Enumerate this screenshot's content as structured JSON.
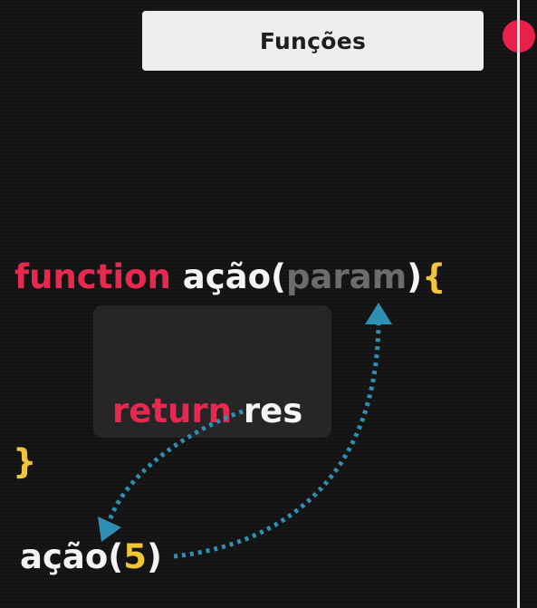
{
  "header": {
    "title": "Funções"
  },
  "code": {
    "line1": {
      "keyword": "function",
      "name": "ação(",
      "param": "param",
      "close_paren": ")",
      "open_brace": "{"
    },
    "line2": {
      "keyword": "return",
      "value": "res"
    },
    "line3": {
      "close_brace": "}"
    },
    "line4": {
      "name": "ação(",
      "arg": "5",
      "close_paren": ")"
    }
  },
  "colors": {
    "background": "#131313",
    "keyword": "#e8294f",
    "identifier": "#f4f4f4",
    "param": "#6c6c6c",
    "brace": "#f0c53a",
    "arrow": "#2f8fb3",
    "dot": "#e8204a",
    "title_card": "#eeeeee"
  }
}
